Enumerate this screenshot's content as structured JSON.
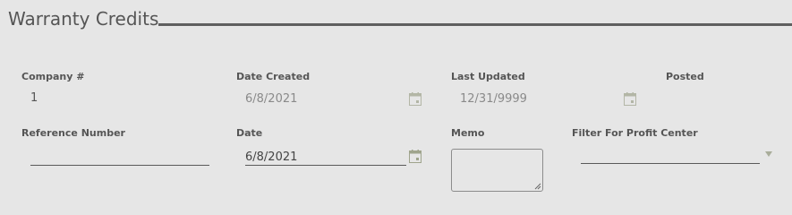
{
  "page": {
    "title": "Warranty Credits"
  },
  "fields": {
    "company": {
      "label": "Company #",
      "value": "1"
    },
    "date_created": {
      "label": "Date Created",
      "value": "6/8/2021"
    },
    "last_updated": {
      "label": "Last Updated",
      "value": "12/31/9999"
    },
    "posted": {
      "label": "Posted"
    },
    "reference_number": {
      "label": "Reference Number",
      "value": ""
    },
    "date": {
      "label": "Date",
      "value": "6/8/2021"
    },
    "memo": {
      "label": "Memo",
      "value": ""
    },
    "filter_profit_center": {
      "label": "Filter For Profit Center",
      "value": ""
    }
  },
  "icons": {
    "calendar": "calendar-icon",
    "dropdown": "chevron-down-icon",
    "resize": "resize-grip-icon"
  },
  "colors": {
    "background": "#e6e6e6",
    "text": "#555555",
    "rule": "#5f5f5f",
    "icon_muted": "#a9ad9a"
  }
}
